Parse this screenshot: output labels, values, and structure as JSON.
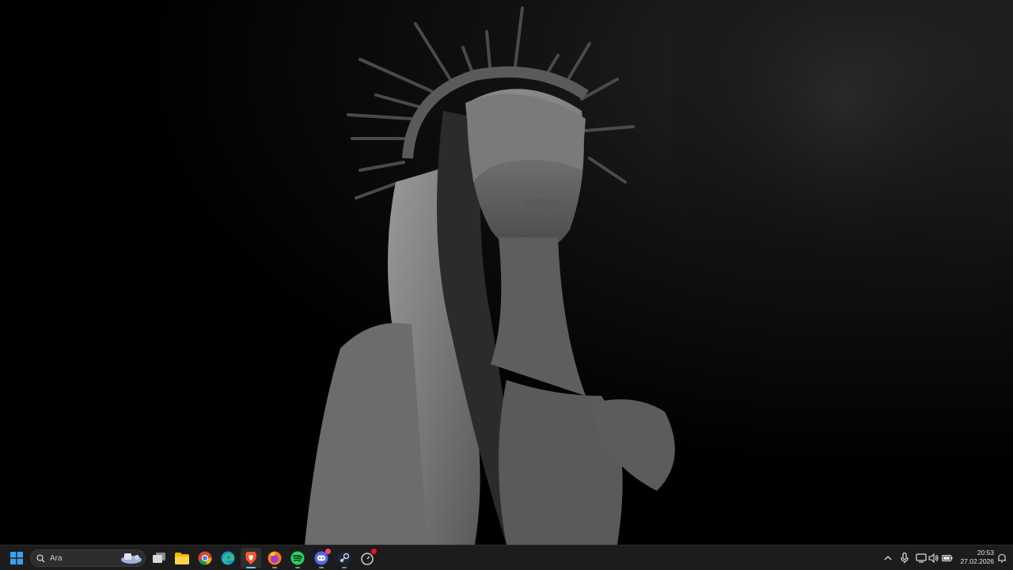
{
  "desktop": {
    "wallpaper": "blindfolded-figure-with-crown-of-thorns"
  },
  "taskbar": {
    "search": {
      "placeholder": "Ara"
    },
    "apps": [
      {
        "name": "start",
        "icon": "windows-icon"
      },
      {
        "name": "task-view",
        "icon": "task-view-icon"
      },
      {
        "name": "file-explorer",
        "icon": "folder-icon"
      },
      {
        "name": "chrome",
        "icon": "chrome-icon"
      },
      {
        "name": "edge",
        "icon": "edge-icon"
      },
      {
        "name": "brave",
        "icon": "brave-icon",
        "active": true
      },
      {
        "name": "firefox",
        "icon": "firefox-icon"
      },
      {
        "name": "spotify",
        "icon": "spotify-icon"
      },
      {
        "name": "discord",
        "icon": "discord-icon"
      },
      {
        "name": "steam",
        "icon": "steam-icon"
      },
      {
        "name": "clock-app",
        "icon": "timer-icon"
      }
    ],
    "tray": {
      "icons": [
        "chevron-up-icon",
        "microphone-icon",
        "network-icon",
        "volume-icon",
        "battery-icon"
      ],
      "time": "20:53",
      "date": "27.02.2026"
    }
  },
  "colors": {
    "taskbar": "#1c1c1c",
    "accent": "#60cdff"
  }
}
